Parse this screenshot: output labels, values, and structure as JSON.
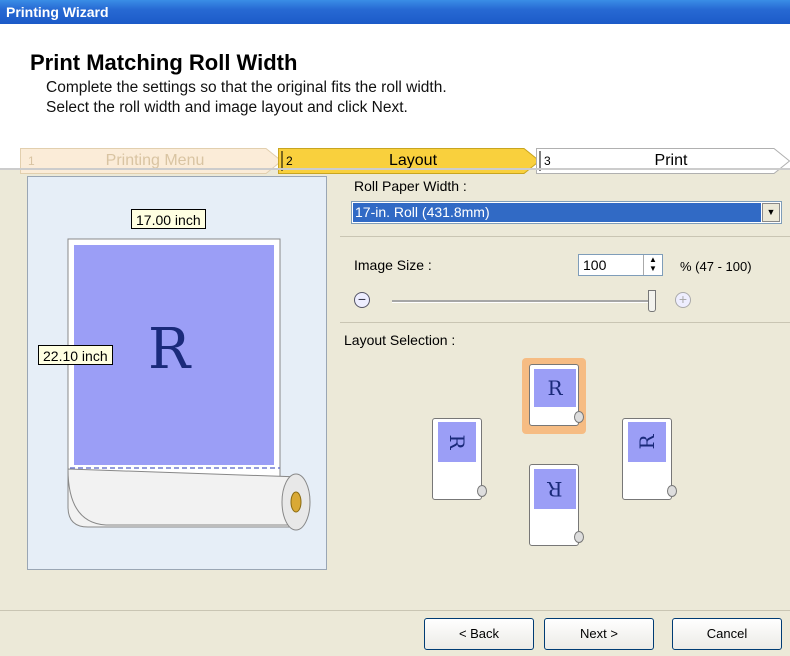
{
  "window": {
    "title": "Printing Wizard"
  },
  "header": {
    "title": "Print Matching Roll Width",
    "line1": "Complete the settings so that the original fits the roll width.",
    "line2": "Select the roll width and image layout and click Next."
  },
  "steps": [
    {
      "num": "1",
      "label": "Printing Menu",
      "state": "done"
    },
    {
      "num": "2",
      "label": "Layout",
      "state": "current"
    },
    {
      "num": "3",
      "label": "Print",
      "state": "upcoming"
    }
  ],
  "preview": {
    "width_label": "17.00 inch",
    "height_label": "22.10 inch",
    "glyph": "R"
  },
  "roll": {
    "label": "Roll Paper Width :",
    "selected": "17-in. Roll (431.8mm)"
  },
  "image_size": {
    "label": "Image Size :",
    "value": "100",
    "range": "% (47 - 100)",
    "slider_level_percent": 100
  },
  "layout_selection": {
    "label": "Layout Selection :",
    "glyph": "R"
  },
  "buttons": {
    "back": "< Back",
    "next": "Next >",
    "cancel": "Cancel"
  },
  "colors": {
    "accent": "#316ac5",
    "step_current": "#f9d03d",
    "image": "#9b9ef6",
    "selected_option": "#f6bc83"
  }
}
